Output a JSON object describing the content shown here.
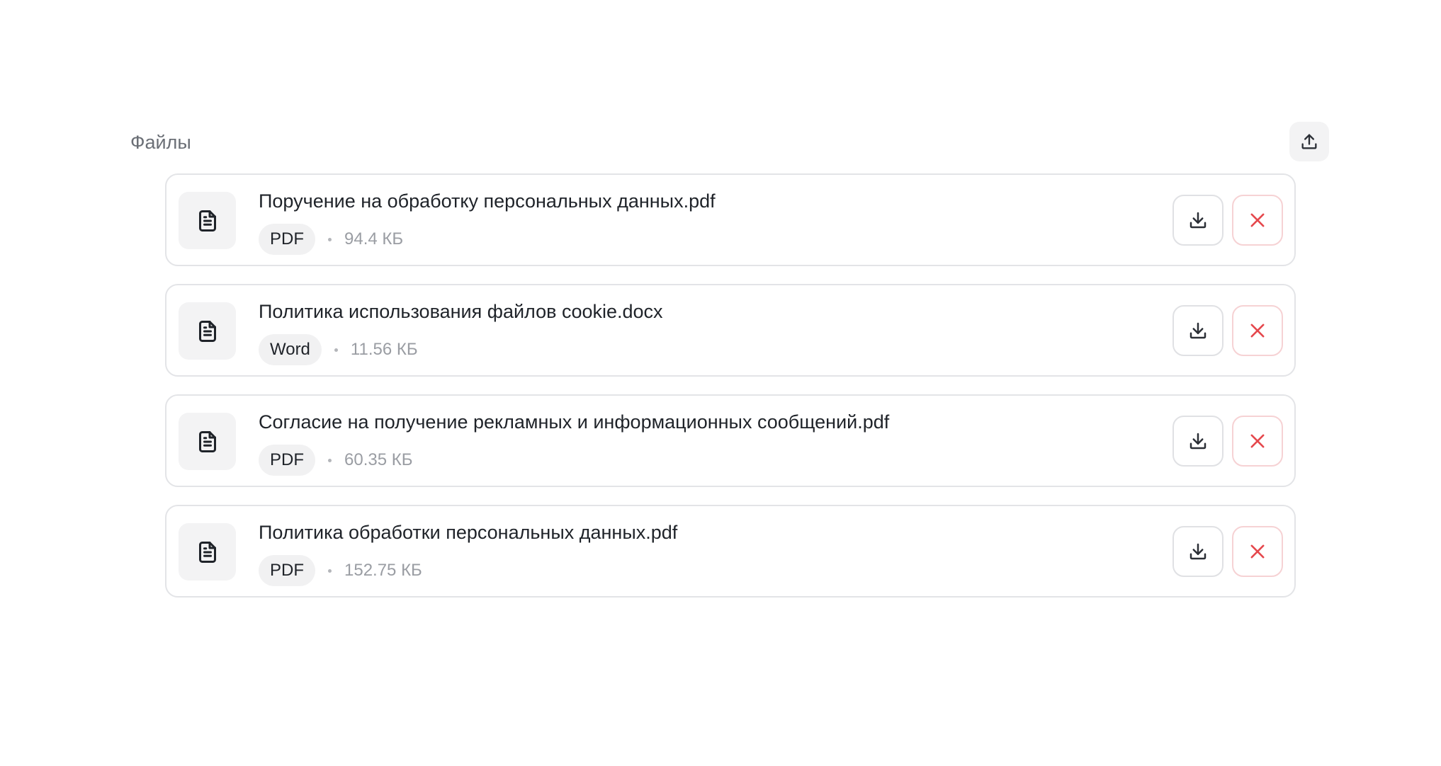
{
  "section": {
    "title": "Файлы",
    "upload_icon": "upload-icon"
  },
  "files": [
    {
      "name": "Поручение на обработку персональных данных.pdf",
      "type": "PDF",
      "size": "94.4 КБ"
    },
    {
      "name": "Политика использования файлов cookie.docx",
      "type": "Word",
      "size": "11.56 КБ"
    },
    {
      "name": "Согласие на получение рекламных и информационных сообщений.pdf",
      "type": "PDF",
      "size": "60.35 КБ"
    },
    {
      "name": "Политика обработки персональных данных.pdf",
      "type": "PDF",
      "size": "152.75 КБ"
    }
  ],
  "icons": {
    "file": "document-icon",
    "download": "download-icon",
    "delete": "close-icon"
  },
  "colors": {
    "delete_accent": "#e5484d",
    "border": "#e3e4e7",
    "muted_text": "#9a9da3"
  }
}
